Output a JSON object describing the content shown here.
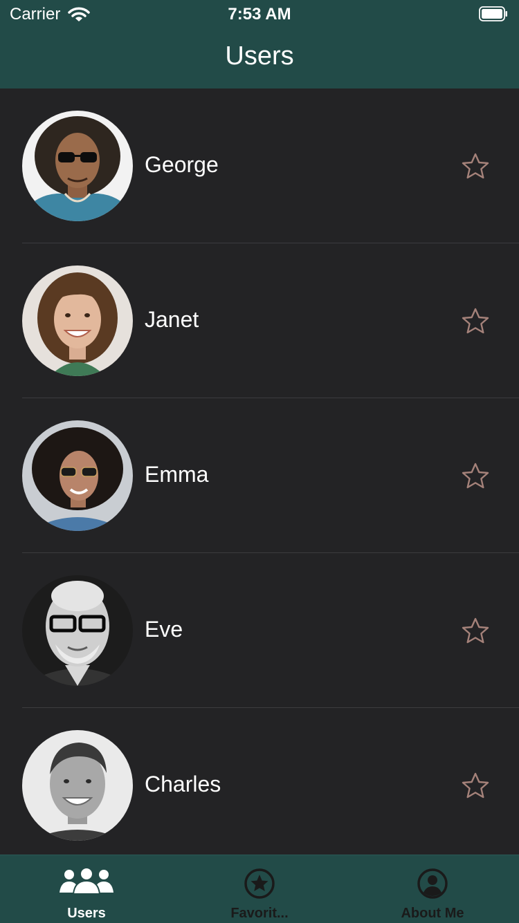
{
  "status_bar": {
    "carrier": "Carrier",
    "time": "7:53 AM"
  },
  "nav": {
    "title": "Users"
  },
  "users": [
    {
      "name": "George",
      "favorite": false
    },
    {
      "name": "Janet",
      "favorite": false
    },
    {
      "name": "Emma",
      "favorite": false
    },
    {
      "name": "Eve",
      "favorite": false
    },
    {
      "name": "Charles",
      "favorite": false
    }
  ],
  "tabs": [
    {
      "label": "Users",
      "icon": "users-icon",
      "selected": true
    },
    {
      "label": "Favorit...",
      "icon": "star-circle-icon",
      "selected": false
    },
    {
      "label": "About Me",
      "icon": "person-circle-icon",
      "selected": false
    }
  ],
  "colors": {
    "header_bg": "#224b48",
    "list_bg": "#232325",
    "star_outline": "#a5827a",
    "tab_selected": "#ffffff",
    "tab_unselected": "#1a1a1a"
  }
}
